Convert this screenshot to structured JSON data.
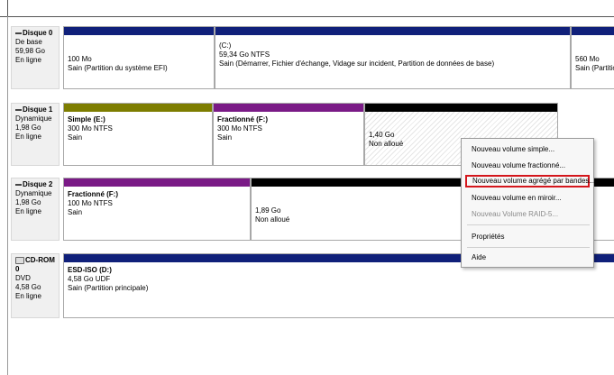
{
  "disks": [
    {
      "name": "Disque 0",
      "icon": "dash-icon",
      "type": "De base",
      "size": "59,98 Go",
      "status": "En ligne",
      "partitions": [
        {
          "title": "",
          "size": "100 Mo",
          "status": "Sain (Partition du système EFI)",
          "bar_color": "#10207a"
        },
        {
          "title": "(C:)",
          "size": "59,34 Go NTFS",
          "status": "Sain (Démarrer, Fichier d'échange, Vidage sur incident, Partition de données de base)",
          "bar_color": "#10207a"
        },
        {
          "title": "",
          "size": "560 Mo",
          "status": "Sain (Partition d",
          "bar_color": "#10207a"
        }
      ]
    },
    {
      "name": "Disque 1",
      "icon": "dash-icon",
      "type": "Dynamique",
      "size": "1,98 Go",
      "status": "En ligne",
      "partitions": [
        {
          "title": "Simple (E:)",
          "size": "300 Mo NTFS",
          "status": "Sain",
          "bar_color": "#7d7d00"
        },
        {
          "title": "Fractionné (F:)",
          "size": "300 Mo NTFS",
          "status": "Sain",
          "bar_color": "#7a1a86"
        },
        {
          "title": "",
          "size": "1,40 Go",
          "status": "Non alloué",
          "bar_color": "#000000"
        }
      ]
    },
    {
      "name": "Disque 2",
      "icon": "dash-icon",
      "type": "Dynamique",
      "size": "1,98 Go",
      "status": "En ligne",
      "partitions": [
        {
          "title": "Fractionné (F:)",
          "size": "100 Mo NTFS",
          "status": "Sain",
          "bar_color": "#7a1a86"
        },
        {
          "title": "",
          "size": "1,89 Go",
          "status": "Non alloué",
          "bar_color": "#000000"
        }
      ]
    },
    {
      "name": "CD-ROM 0",
      "icon": "cdrom-icon",
      "type": "DVD",
      "size": "4,58 Go",
      "status": "En ligne",
      "partitions": [
        {
          "title": "ESD-ISO (D:)",
          "size": "4,58 Go UDF",
          "status": "Sain (Partition principale)",
          "bar_color": "#10207a"
        }
      ]
    }
  ],
  "context_menu": {
    "items": [
      {
        "label": "Nouveau volume simple...",
        "enabled": true
      },
      {
        "label": "Nouveau volume fractionné...",
        "enabled": true
      },
      {
        "label": "Nouveau volume agrégé par bandes...",
        "enabled": true,
        "highlighted": true
      },
      {
        "label": "Nouveau volume en miroir...",
        "enabled": true
      },
      {
        "label": "Nouveau Volume RAID-5...",
        "enabled": false
      },
      {
        "label": "Propriétés",
        "enabled": true
      },
      {
        "label": "Aide",
        "enabled": true
      }
    ]
  },
  "colors": {
    "primary_partition": "#10207a",
    "simple_volume": "#7d7d00",
    "spanned_volume": "#7a1a86",
    "unallocated": "#000000",
    "highlight_border": "#d4161c"
  }
}
